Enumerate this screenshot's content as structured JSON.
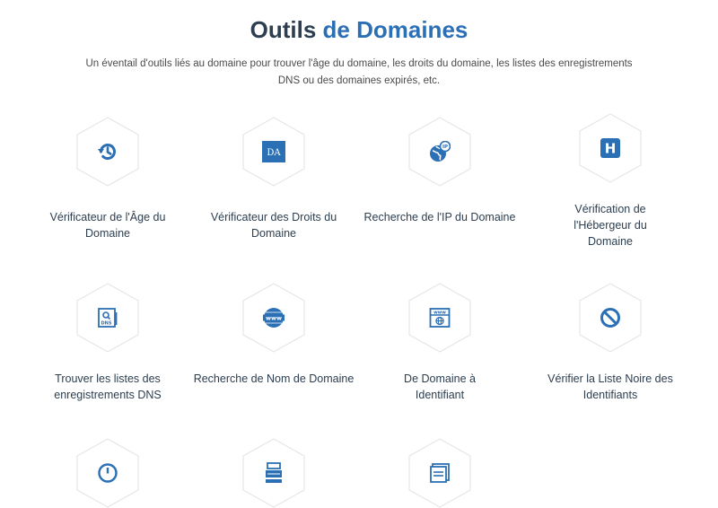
{
  "header": {
    "title_main": "Outils",
    "title_accent": "de Domaines",
    "subtitle": "Un éventail d'outils liés au domaine pour trouver l'âge du domaine, les droits du domaine, les listes des enregistrements DNS ou des domaines expirés, etc."
  },
  "colors": {
    "accent": "#2b6fb5",
    "title": "#2c3e50",
    "hex_border": "#e3e6ea"
  },
  "tools": [
    {
      "label": "Vérificateur de l'Âge du Domaine",
      "icon": "history-icon"
    },
    {
      "label": "Vérificateur des Droits du Domaine",
      "icon": "da-icon",
      "icon_text": "DA"
    },
    {
      "label": "Recherche de l'IP du Domaine",
      "icon": "globe-ip-icon",
      "icon_text": "IP"
    },
    {
      "label": "Vérification de l'Hébergeur du Domaine",
      "icon": "hosting-h-icon",
      "icon_text": "H"
    },
    {
      "label": "Trouver les listes des enregistrements DNS",
      "icon": "dns-search-icon",
      "icon_text": "DNS"
    },
    {
      "label": "Recherche de Nom de Domaine",
      "icon": "www-icon",
      "icon_text": "www"
    },
    {
      "label": "De Domaine à Identifiant",
      "icon": "browser-www-icon",
      "icon_text": "www"
    },
    {
      "label": "Vérifier la Liste Noire des Identifiants",
      "icon": "blocked-icon"
    },
    {
      "label": "",
      "icon": "clock-icon"
    },
    {
      "label": "",
      "icon": "server-icon"
    },
    {
      "label": "",
      "icon": "window-list-icon"
    }
  ]
}
